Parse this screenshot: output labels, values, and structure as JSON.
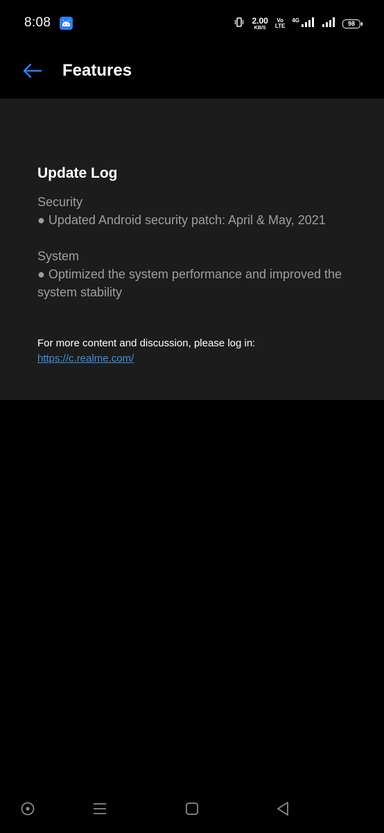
{
  "status_bar": {
    "time": "8:08",
    "app_icon": "android-debug-icon",
    "net_speed_value": "2.00",
    "net_speed_unit": "KB/S",
    "volte_top": "Vo",
    "volte_bottom": "LTE",
    "network_type": "4G",
    "battery": "98",
    "icons": [
      "vibrate-icon",
      "signal-icon",
      "signal-icon"
    ]
  },
  "header": {
    "back_icon": "arrow-left-icon",
    "title": "Features"
  },
  "content": {
    "heading": "Update Log",
    "sections": [
      {
        "title": "Security",
        "items": [
          "● Updated Android security patch: April & May, 2021"
        ]
      },
      {
        "title": "System",
        "items": [
          "● Optimized the system performance and improved the system stability"
        ]
      }
    ],
    "login_note": "For more content and discussion, please log in:",
    "login_link": "https://c.realme.com/"
  },
  "nav_bar": {
    "icons": [
      "assistant-circle-icon",
      "menu-icon",
      "home-square-icon",
      "back-triangle-icon"
    ]
  },
  "colors": {
    "background": "#000000",
    "card": "#1c1c1c",
    "accent": "#2e7cf6",
    "link": "#3d8fdc",
    "muted_text": "#9e9e9e"
  }
}
